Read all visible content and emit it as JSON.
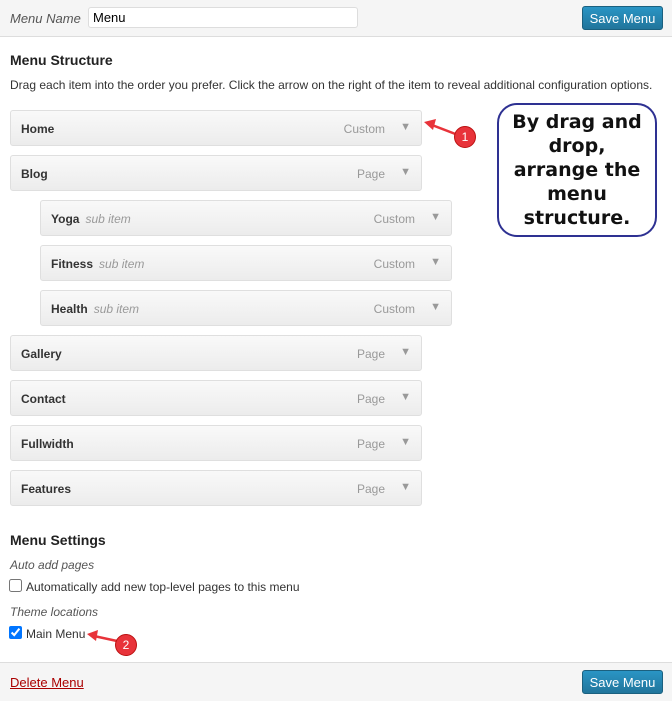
{
  "header": {
    "menu_name_label": "Menu Name",
    "menu_name_value": "Menu",
    "save_label": "Save Menu"
  },
  "structure": {
    "title": "Menu Structure",
    "instructions": "Drag each item into the order you prefer. Click the arrow on the right of the item to reveal additional configuration options.",
    "items": [
      {
        "title": "Home",
        "type": "Custom",
        "sub": ""
      },
      {
        "title": "Blog",
        "type": "Page",
        "sub": ""
      },
      {
        "title": "Yoga",
        "type": "Custom",
        "sub": "sub item"
      },
      {
        "title": "Fitness",
        "type": "Custom",
        "sub": "sub item"
      },
      {
        "title": "Health",
        "type": "Custom",
        "sub": "sub item"
      },
      {
        "title": "Gallery",
        "type": "Page",
        "sub": ""
      },
      {
        "title": "Contact",
        "type": "Page",
        "sub": ""
      },
      {
        "title": "Fullwidth",
        "type": "Page",
        "sub": ""
      },
      {
        "title": "Features",
        "type": "Page",
        "sub": ""
      }
    ],
    "arrow_glyph": "▼"
  },
  "settings": {
    "title": "Menu Settings",
    "auto_add_label": "Auto add pages",
    "auto_add_option": "Automatically add new top-level pages to this menu",
    "auto_add_checked": false,
    "theme_locations_label": "Theme locations",
    "main_menu_option": "Main Menu",
    "main_menu_checked": true
  },
  "footer": {
    "delete_label": "Delete Menu",
    "save_label": "Save Menu"
  },
  "annotations": {
    "callout": "By drag and drop, arrange the menu structure.",
    "badge1": "1",
    "badge2": "2",
    "callout_border": "#2e3192",
    "badge_color": "#e8333a"
  }
}
